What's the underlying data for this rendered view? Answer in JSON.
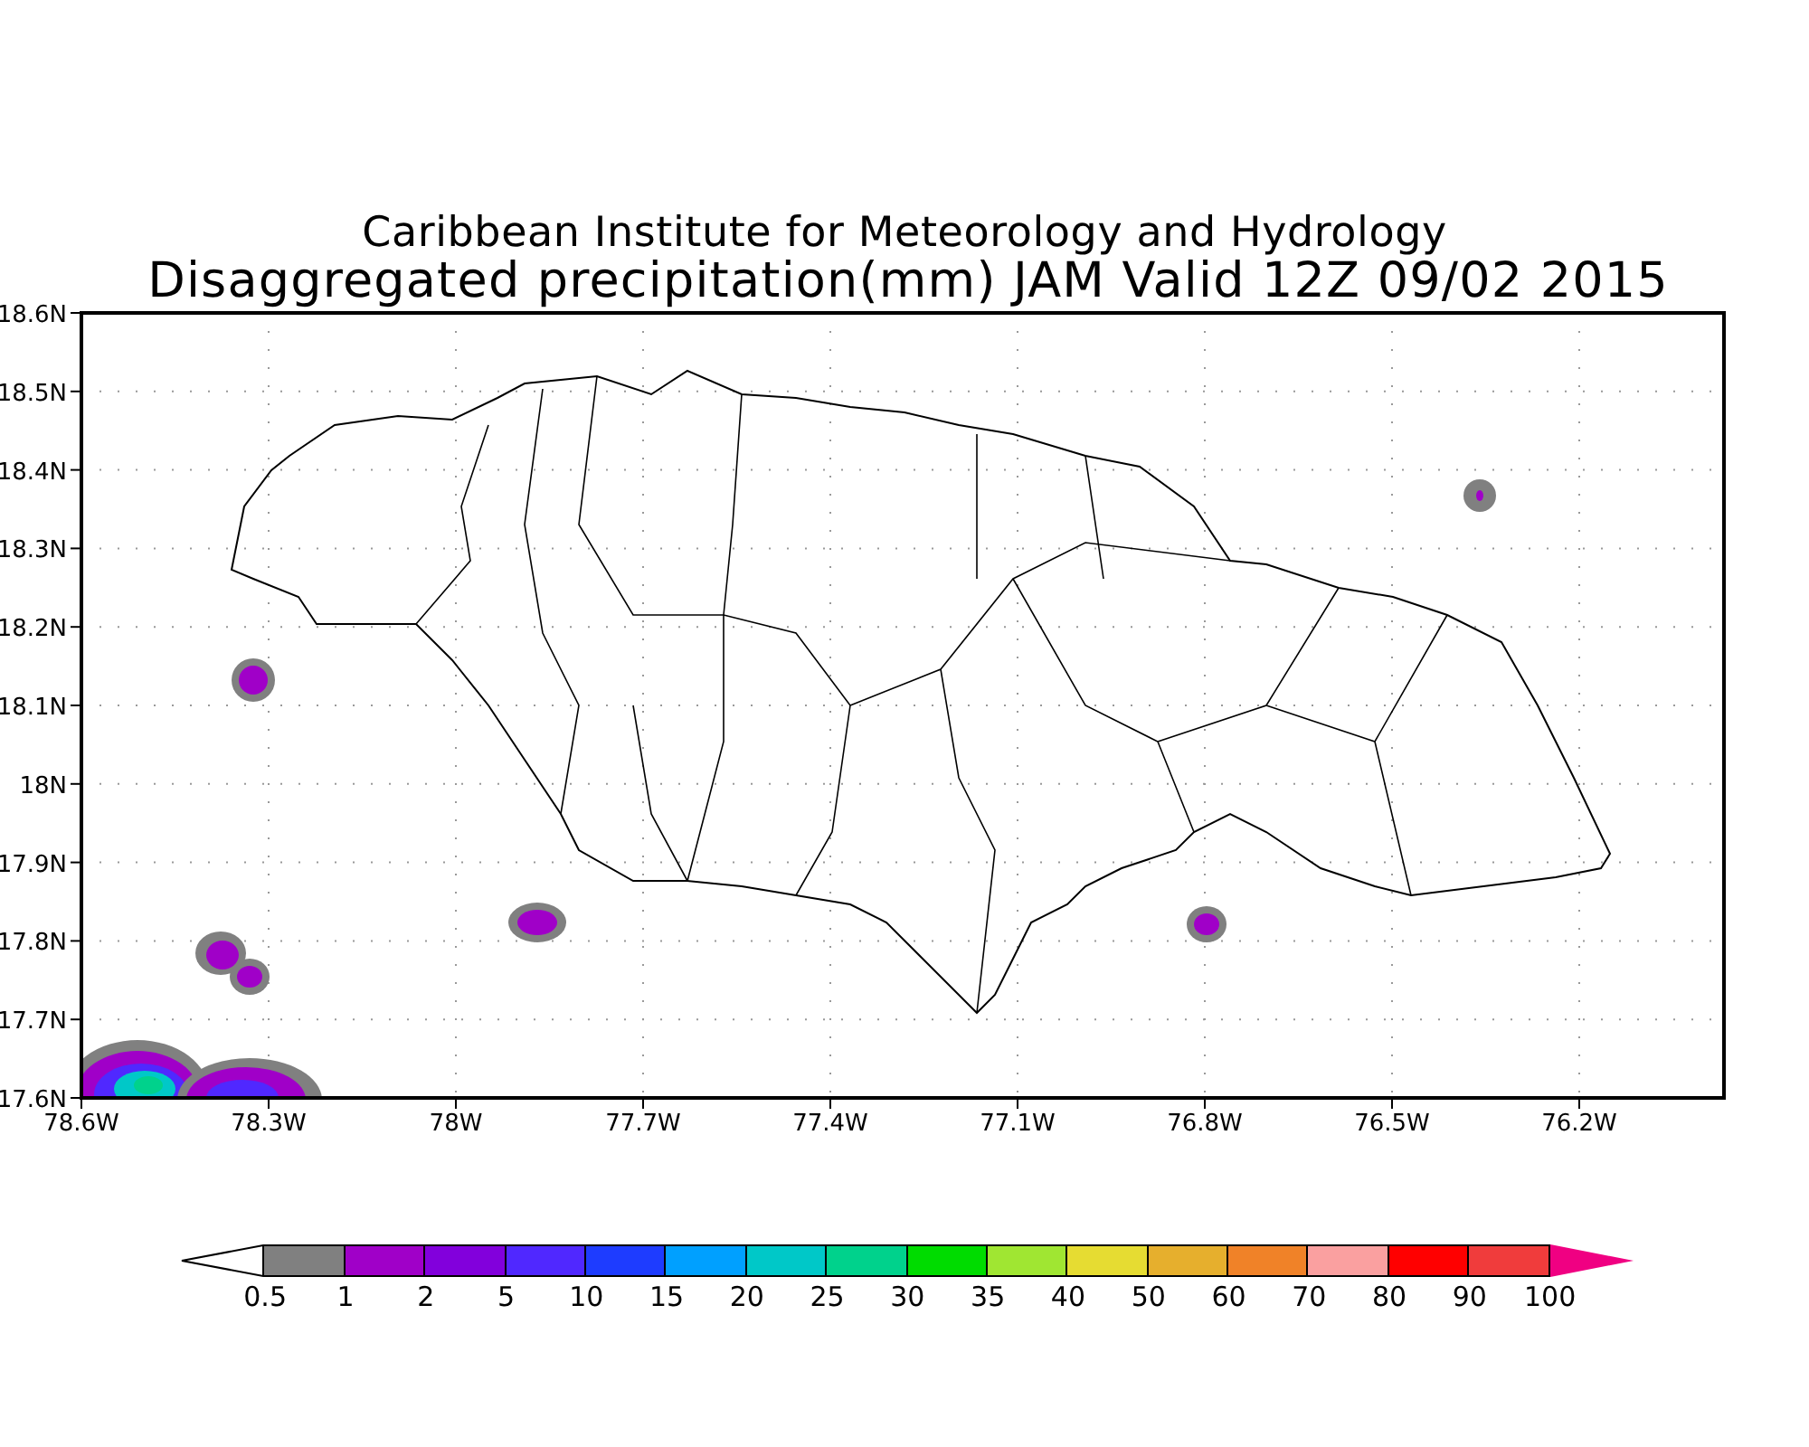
{
  "title": {
    "line_1": "Caribbean Institute for Meteorology and Hydrology",
    "line_2": "Disaggregated precipitation(mm) JAM Valid 12Z 09/02 2015"
  },
  "map": {
    "yticks": [
      "18.6N",
      "18.5N",
      "18.4N",
      "18.3N",
      "18.2N",
      "18.1N",
      "18N",
      "17.9N",
      "17.8N",
      "17.7N",
      "17.6N"
    ],
    "xticks": [
      "78.6W",
      "78.3W",
      "78W",
      "77.7W",
      "77.4W",
      "77.1W",
      "76.8W",
      "76.5W",
      "76.2W"
    ]
  },
  "colorbar": {
    "bins": [
      {
        "kind": "below",
        "color": "#ffffff"
      },
      {
        "color": "#808080"
      },
      {
        "color": "#a000c8"
      },
      {
        "color": "#8200dc"
      },
      {
        "color": "#5028ff"
      },
      {
        "color": "#1e3cff"
      },
      {
        "color": "#00a0ff"
      },
      {
        "color": "#00c8c8"
      },
      {
        "color": "#00d28c"
      },
      {
        "color": "#00dc00"
      },
      {
        "color": "#a0e632"
      },
      {
        "color": "#e6dc32"
      },
      {
        "color": "#e6af2d"
      },
      {
        "color": "#f08228"
      },
      {
        "color": "#faa0a0"
      },
      {
        "color": "#ff0000"
      },
      {
        "color": "#f03c3c"
      },
      {
        "kind": "above",
        "color": "#f00082"
      }
    ],
    "labels": [
      "0.5",
      "1",
      "2",
      "5",
      "10",
      "15",
      "20",
      "25",
      "30",
      "35",
      "40",
      "50",
      "60",
      "70",
      "80",
      "90",
      "100"
    ]
  }
}
